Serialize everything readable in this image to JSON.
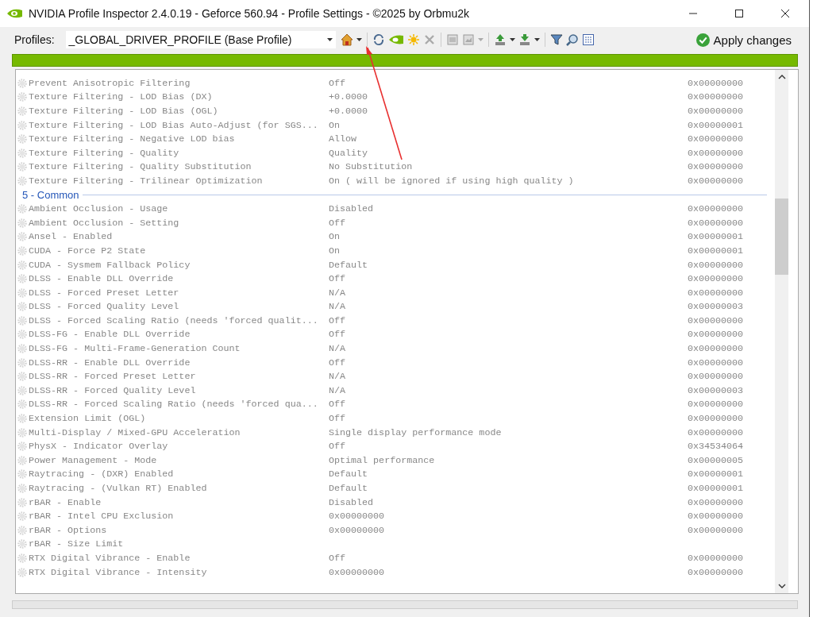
{
  "window": {
    "title": "NVIDIA Profile Inspector 2.4.0.19 - Geforce 560.94 - Profile Settings - ©2025 by Orbmu2k"
  },
  "toolbar": {
    "profiles_label": "Profiles:",
    "profile": "_GLOBAL_DRIVER_PROFILE (Base Profile)",
    "apply_label": "Apply changes"
  },
  "rows": [
    {
      "kind": "setting",
      "name": "Prevent Anisotropic Filtering",
      "value": "Off",
      "hex": "0x00000000"
    },
    {
      "kind": "setting",
      "name": "Texture Filtering - LOD Bias (DX)",
      "value": "+0.0000",
      "hex": "0x00000000"
    },
    {
      "kind": "setting",
      "name": "Texture Filtering - LOD Bias (OGL)",
      "value": "+0.0000",
      "hex": "0x00000000"
    },
    {
      "kind": "setting",
      "name": "Texture Filtering - LOD Bias Auto-Adjust (for SGS...",
      "value": "On",
      "hex": "0x00000001"
    },
    {
      "kind": "setting",
      "name": "Texture Filtering - Negative LOD bias",
      "value": "Allow",
      "hex": "0x00000000"
    },
    {
      "kind": "setting",
      "name": "Texture Filtering - Quality",
      "value": "Quality",
      "hex": "0x00000000"
    },
    {
      "kind": "setting",
      "name": "Texture Filtering - Quality Substitution",
      "value": "No Substitution",
      "hex": "0x00000000"
    },
    {
      "kind": "setting",
      "name": "Texture Filtering - Trilinear Optimization",
      "value": "On ( will be ignored if using high quality )",
      "hex": "0x00000000"
    },
    {
      "kind": "group",
      "name": "5 - Common"
    },
    {
      "kind": "setting",
      "name": "Ambient Occlusion  - Usage",
      "value": "Disabled",
      "hex": "0x00000000"
    },
    {
      "kind": "setting",
      "name": "Ambient Occlusion - Setting",
      "value": "Off",
      "hex": "0x00000000"
    },
    {
      "kind": "setting",
      "name": "Ansel - Enabled",
      "value": "On",
      "hex": "0x00000001"
    },
    {
      "kind": "setting",
      "name": "CUDA - Force P2 State",
      "value": "On",
      "hex": "0x00000001"
    },
    {
      "kind": "setting",
      "name": "CUDA - Sysmem Fallback Policy",
      "value": "Default",
      "hex": "0x00000000"
    },
    {
      "kind": "setting",
      "name": "DLSS - Enable DLL Override",
      "value": "Off",
      "hex": "0x00000000"
    },
    {
      "kind": "setting",
      "name": "DLSS - Forced Preset Letter",
      "value": "N/A",
      "hex": "0x00000000"
    },
    {
      "kind": "setting",
      "name": "DLSS - Forced Quality Level",
      "value": "N/A",
      "hex": "0x00000003"
    },
    {
      "kind": "setting",
      "name": "DLSS - Forced Scaling Ratio (needs 'forced qualit...",
      "value": "Off",
      "hex": "0x00000000"
    },
    {
      "kind": "setting",
      "name": "DLSS-FG - Enable DLL Override",
      "value": "Off",
      "hex": "0x00000000"
    },
    {
      "kind": "setting",
      "name": "DLSS-FG - Multi-Frame-Generation Count",
      "value": "N/A",
      "hex": "0x00000000"
    },
    {
      "kind": "setting",
      "name": "DLSS-RR - Enable DLL Override",
      "value": "Off",
      "hex": "0x00000000"
    },
    {
      "kind": "setting",
      "name": "DLSS-RR - Forced Preset Letter",
      "value": "N/A",
      "hex": "0x00000000"
    },
    {
      "kind": "setting",
      "name": "DLSS-RR - Forced Quality Level",
      "value": "N/A",
      "hex": "0x00000003"
    },
    {
      "kind": "setting",
      "name": "DLSS-RR - Forced Scaling Ratio (needs 'forced qua...",
      "value": "Off",
      "hex": "0x00000000"
    },
    {
      "kind": "setting",
      "name": "Extension Limit (OGL)",
      "value": "Off",
      "hex": "0x00000000"
    },
    {
      "kind": "setting",
      "name": "Multi-Display / Mixed-GPU Acceleration",
      "value": "Single display performance mode",
      "hex": "0x00000000"
    },
    {
      "kind": "setting",
      "name": "PhysX - Indicator Overlay",
      "value": "Off",
      "hex": "0x34534064"
    },
    {
      "kind": "setting",
      "name": "Power Management - Mode",
      "value": "Optimal performance",
      "hex": "0x00000005"
    },
    {
      "kind": "setting",
      "name": "Raytracing - (DXR) Enabled",
      "value": "Default",
      "hex": "0x00000001"
    },
    {
      "kind": "setting",
      "name": "Raytracing - (Vulkan RT) Enabled",
      "value": "Default",
      "hex": "0x00000001"
    },
    {
      "kind": "setting",
      "name": "rBAR - Enable",
      "value": "Disabled",
      "hex": "0x00000000"
    },
    {
      "kind": "setting",
      "name": "rBAR - Intel CPU Exclusion",
      "value": "0x00000000",
      "hex": "0x00000000"
    },
    {
      "kind": "setting",
      "name": "rBAR - Options",
      "value": "0x00000000",
      "hex": "0x00000000"
    },
    {
      "kind": "setting",
      "name": "rBAR - Size Limit"
    },
    {
      "kind": "setting",
      "name": "RTX Digital Vibrance - Enable",
      "value": "Off",
      "hex": "0x00000000"
    },
    {
      "kind": "setting",
      "name": "RTX Digital Vibrance - Intensity",
      "value": "0x00000000",
      "hex": "0x00000000"
    }
  ]
}
